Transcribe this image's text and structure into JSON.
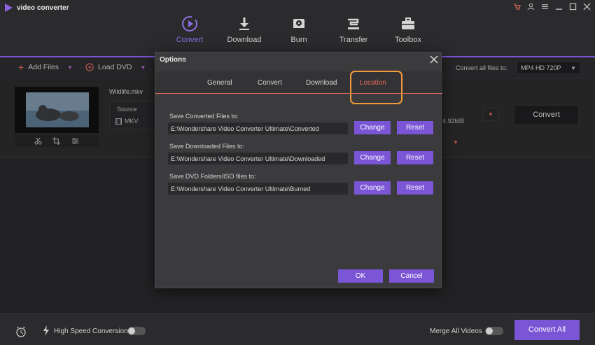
{
  "app": {
    "title": "video converter"
  },
  "nav": [
    {
      "label": "Convert",
      "icon": "convert-icon"
    },
    {
      "label": "Download",
      "icon": "download-icon"
    },
    {
      "label": "Burn",
      "icon": "burn-icon"
    },
    {
      "label": "Transfer",
      "icon": "transfer-icon"
    },
    {
      "label": "Toolbox",
      "icon": "toolbox-icon"
    }
  ],
  "toolbar": {
    "add_files": "Add Files",
    "load_dvd": "Load DVD",
    "convert_all_to": "Convert all files to:",
    "format": "MP4 HD 720P"
  },
  "file": {
    "name": "Wildlife.mkv",
    "source_label": "Source",
    "source_format": "MKV",
    "size": "4.92MB",
    "convert_button": "Convert"
  },
  "bottom": {
    "high_speed": "High Speed Conversion",
    "merge": "Merge All Videos",
    "convert_all": "Convert All"
  },
  "dialog": {
    "title": "Options",
    "tabs": [
      "General",
      "Convert",
      "Download",
      "Location"
    ],
    "active_tab": "Location",
    "fields": [
      {
        "label": "Save Converted Files to:",
        "value": "E:\\Wondershare Video Converter Ultimate\\Converted"
      },
      {
        "label": "Save Downloaded Files to:",
        "value": "E:\\Wondershare Video Converter Ultimate\\Downloaded"
      },
      {
        "label": "Save DVD Folders/ISO files to:",
        "value": "E:\\Wondershare Video Converter Ultimate\\Burned"
      }
    ],
    "change": "Change",
    "reset": "Reset",
    "ok": "OK",
    "cancel": "Cancel"
  },
  "colors": {
    "accent": "#7a55d6",
    "highlight": "#e26a5c",
    "annotation": "#f29a3d"
  }
}
